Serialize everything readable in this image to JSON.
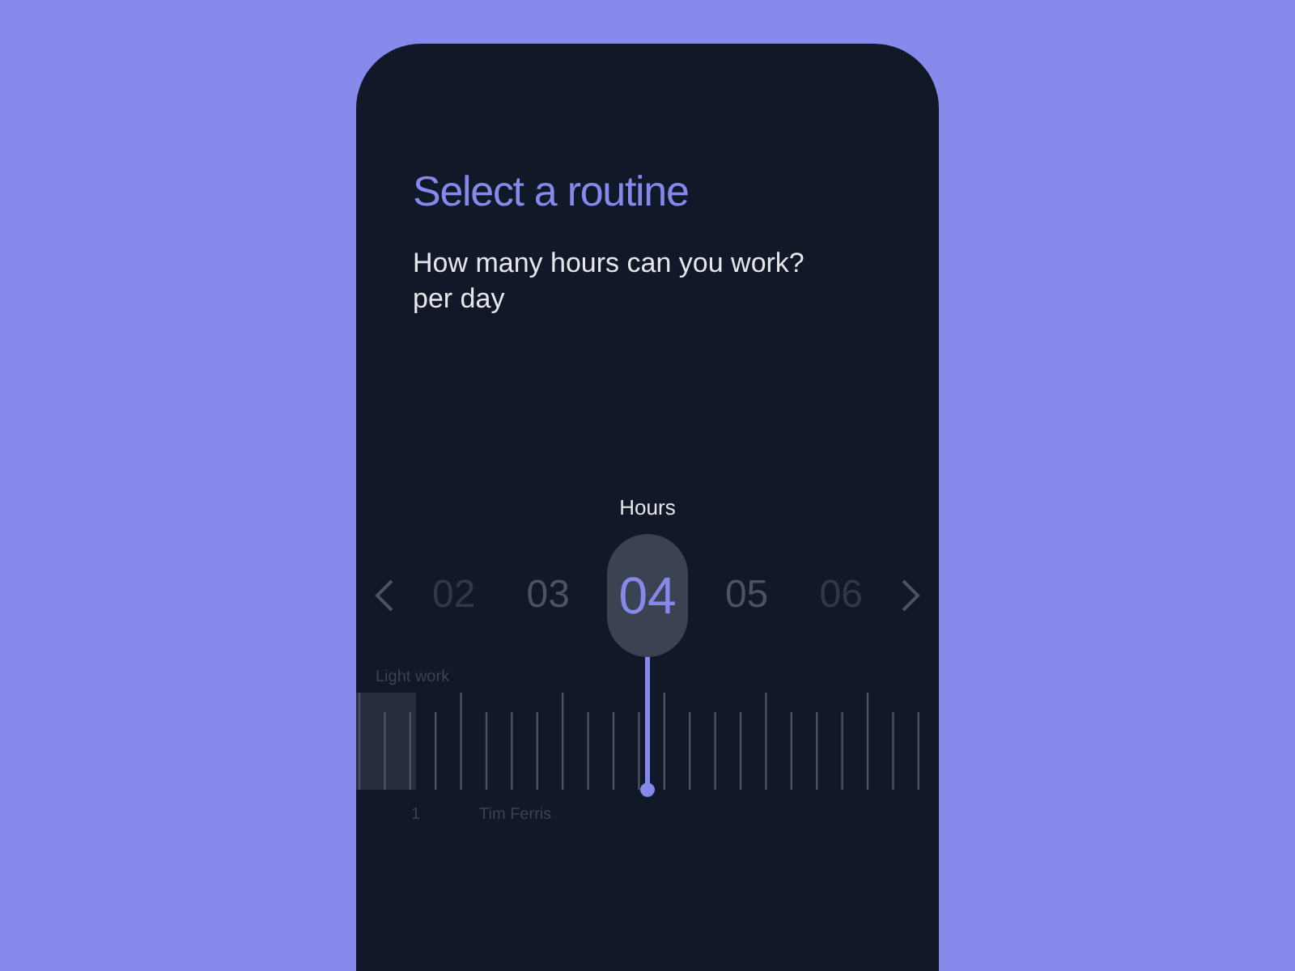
{
  "title": "Select a routine",
  "question": "How many hours can you work?",
  "subtitle": "per day",
  "picker": {
    "label": "Hours",
    "options": [
      {
        "value": "02",
        "selected": false
      },
      {
        "value": "03",
        "selected": false
      },
      {
        "value": "04",
        "selected": true
      },
      {
        "value": "05",
        "selected": false
      },
      {
        "value": "06",
        "selected": false
      }
    ]
  },
  "ruler": {
    "range_label": "Light work",
    "start_label": "1",
    "marker_label": "Tim Ferris"
  }
}
